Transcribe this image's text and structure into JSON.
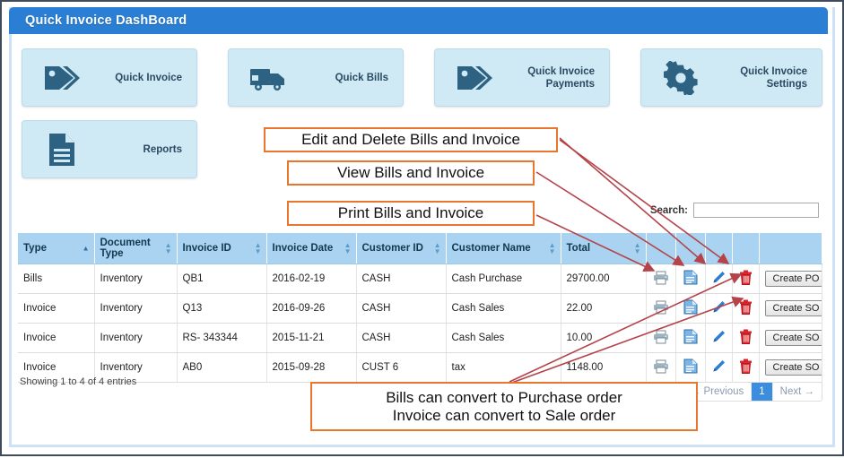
{
  "window": {
    "title": "Quick Invoice DashBoard"
  },
  "tiles": [
    {
      "id": "quick-invoice",
      "label": "Quick Invoice",
      "icon": "tag-icon"
    },
    {
      "id": "quick-bills",
      "label": "Quick Bills",
      "icon": "truck-icon"
    },
    {
      "id": "quick-payments",
      "label": "Quick Invoice\nPayments",
      "icon": "tag-icon"
    },
    {
      "id": "quick-settings",
      "label": "Quick Invoice\nSettings",
      "icon": "gear-icon"
    },
    {
      "id": "reports",
      "label": "Reports",
      "icon": "document-icon"
    }
  ],
  "annotations": {
    "edit_delete": "Edit and Delete Bills and Invoice",
    "view": "View Bills and Invoice",
    "print": "Print Bills and Invoice",
    "convert_line1": "Bills can convert to Purchase order",
    "convert_line2": "Invoice can convert to Sale order"
  },
  "search": {
    "label": "Search:",
    "value": "",
    "placeholder": ""
  },
  "table": {
    "columns": [
      {
        "label": "Type",
        "sort": "asc"
      },
      {
        "label": "Document Type",
        "sort": "both"
      },
      {
        "label": "Invoice ID",
        "sort": "both"
      },
      {
        "label": "Invoice Date",
        "sort": "both"
      },
      {
        "label": "Customer ID",
        "sort": "both"
      },
      {
        "label": "Customer Name",
        "sort": "both"
      },
      {
        "label": "Total",
        "sort": "both"
      },
      {
        "label": "",
        "sort": "none"
      },
      {
        "label": "",
        "sort": "none"
      },
      {
        "label": "",
        "sort": "none"
      },
      {
        "label": "",
        "sort": "none"
      },
      {
        "label": "",
        "sort": "none"
      }
    ],
    "rows": [
      {
        "type": "Bills",
        "doc_type": "Inventory",
        "invoice_id": "QB1",
        "invoice_date": "2016-02-19",
        "customer_id": "CASH",
        "customer_name": "Cash Purchase",
        "total": "29700.00",
        "action_button": "Create PO"
      },
      {
        "type": "Invoice",
        "doc_type": "Inventory",
        "invoice_id": "Q13",
        "invoice_date": "2016-09-26",
        "customer_id": "CASH",
        "customer_name": "Cash Sales",
        "total": "22.00",
        "action_button": "Create SO"
      },
      {
        "type": "Invoice",
        "doc_type": "Inventory",
        "invoice_id": "RS- 343344",
        "invoice_date": "2015-11-21",
        "customer_id": "CASH",
        "customer_name": "Cash Sales",
        "total": "10.00",
        "action_button": "Create SO"
      },
      {
        "type": "Invoice",
        "doc_type": "Inventory",
        "invoice_id": "AB0",
        "invoice_date": "2015-09-28",
        "customer_id": "CUST 6",
        "customer_name": "tax",
        "total": "1148.00",
        "action_button": "Create SO"
      }
    ],
    "row_icons": [
      "print-icon",
      "view-document-icon",
      "edit-pencil-icon",
      "delete-trash-icon"
    ]
  },
  "footer": {
    "showing": "Showing 1 to 4 of 4 entries",
    "previous": "← Previous",
    "page_current": "1",
    "next": "Next →"
  },
  "colors": {
    "title_bar": "#2a7fd4",
    "tile_bg": "#cfe9f5",
    "table_header": "#a9d3f0",
    "annotation_border": "#e8762d",
    "arrow": "#b5434a",
    "pagination_active": "#3c8dde",
    "trash_red": "#d8232a",
    "icon_blue": "#3a7fc1"
  }
}
